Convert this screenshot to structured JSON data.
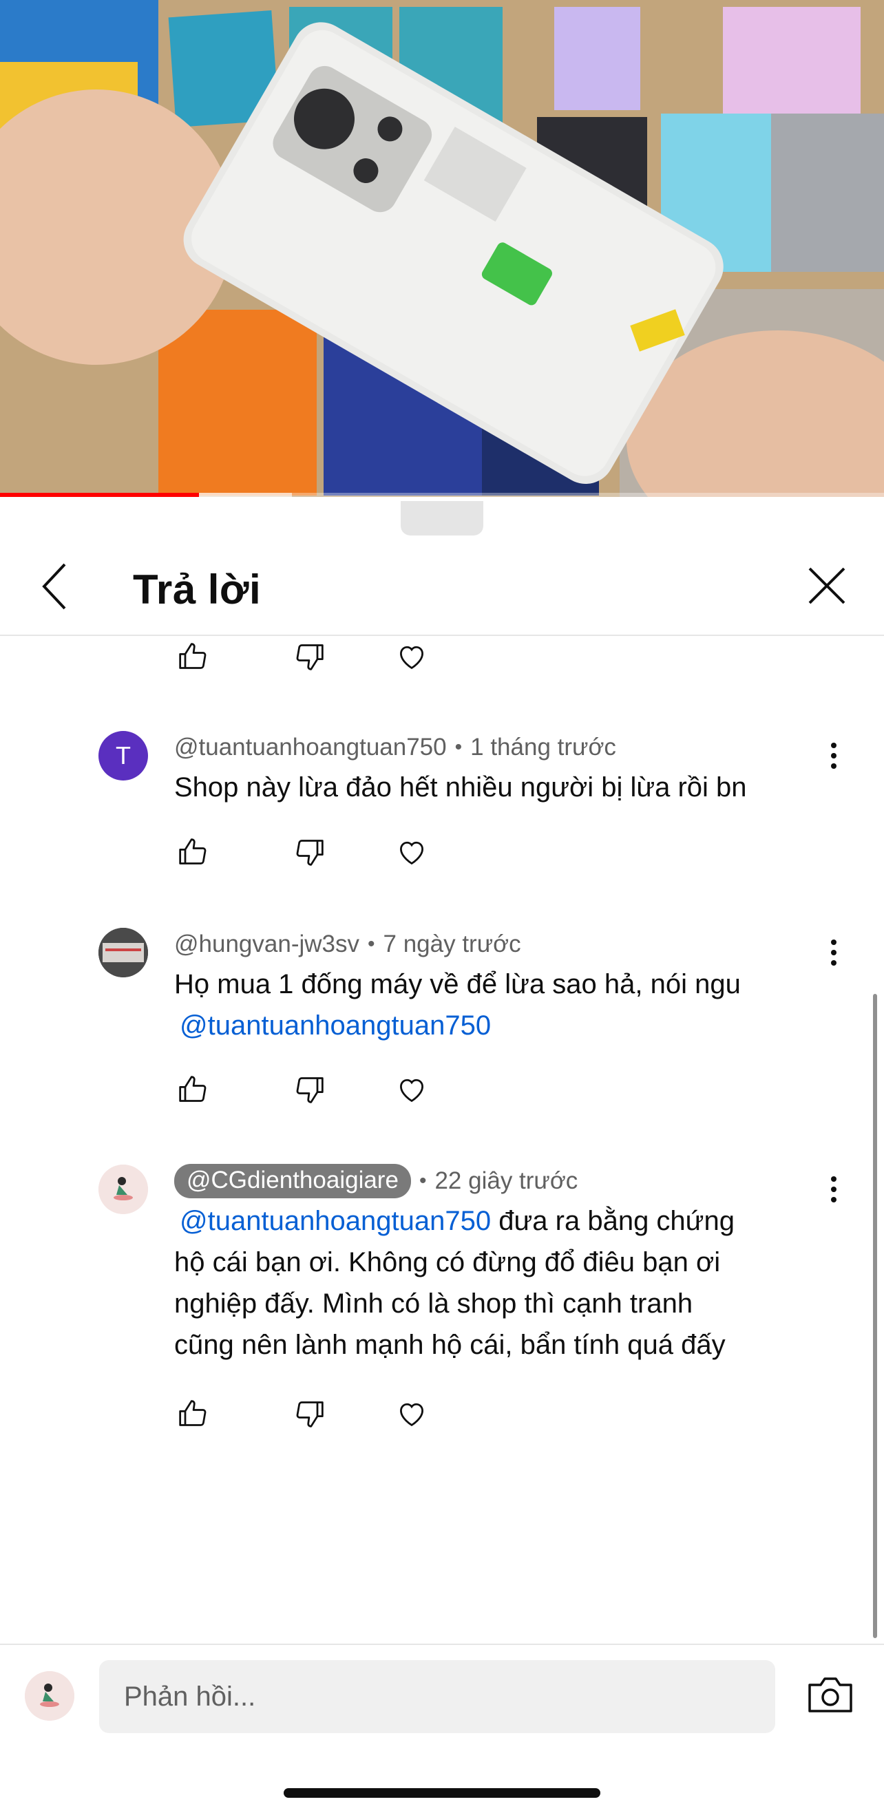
{
  "video": {
    "progress_fraction": 0.225,
    "buffer_fraction": 0.33,
    "colors": {
      "played": "#ff0000"
    }
  },
  "header": {
    "title": "Trả lời"
  },
  "comments": [
    {
      "avatar_letter": "T",
      "author": "@tuantuanhoangtuan750",
      "time": "1 tháng trước",
      "text": "Shop này lừa đảo hết nhiều người bị lừa rồi bn"
    },
    {
      "author": "@hungvan-jw3sv",
      "time": "7 ngày trước",
      "text": "Họ mua 1 đống máy về để lừa sao hả, nói ngu",
      "mention": "@tuantuanhoangtuan750"
    },
    {
      "author": "@CGdienthoaigiare",
      "time": "22 giây trước",
      "mention": "@tuantuanhoangtuan750",
      "text_after_mention": "đưa ra bằng chứng",
      "text_lines": [
        "hộ cái bạn ơi. Không có đừng đổ điêu bạn ơi",
        "nghiệp đấy. Mình có là shop thì cạnh tranh",
        "cũng nên lành mạnh hộ cái, bẩn tính quá đấy"
      ]
    }
  ],
  "reply": {
    "placeholder": "Phản hồi..."
  },
  "icons": {
    "back": "chevron-left-icon",
    "close": "close-icon",
    "like": "thumb-up-icon",
    "dislike": "thumb-down-icon",
    "heart": "heart-icon",
    "more": "more-vert-icon",
    "camera": "camera-icon"
  },
  "colors": {
    "mention": "#065fd4",
    "avatar_letter_bg": "#5a2fbf",
    "pill_bg": "#7a7a7a"
  }
}
